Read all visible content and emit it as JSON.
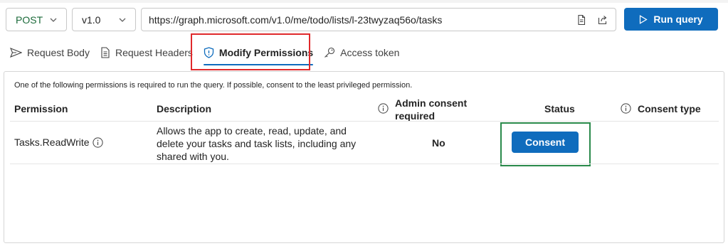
{
  "query_bar": {
    "method": "POST",
    "version": "v1.0",
    "url": "https://graph.microsoft.com/v1.0/me/todo/lists/l-23twyzaq56o/tasks",
    "run_label": "Run query"
  },
  "tabs": [
    {
      "label": "Request Body",
      "icon": "send-icon"
    },
    {
      "label": "Request Headers",
      "icon": "document-icon"
    },
    {
      "label": "Modify Permissions",
      "icon": "shield-icon",
      "active": true
    },
    {
      "label": "Access token",
      "icon": "key-icon"
    }
  ],
  "permissions": {
    "note": "One of the following permissions is required to run the query. If possible, consent to the least privileged permission.",
    "headers": {
      "permission": "Permission",
      "description": "Description",
      "admin_line1": "Admin consent",
      "admin_line2": "required",
      "status": "Status",
      "consent_type": "Consent type"
    },
    "rows": [
      {
        "permission": "Tasks.ReadWrite",
        "description_lines": [
          "Allows the app to create, read, update, and",
          "delete your tasks and task lists, including any",
          "shared with you."
        ],
        "admin_required": "No",
        "action": "Consent"
      }
    ]
  },
  "colors": {
    "accent": "#0f6cbd",
    "method_text": "#1b6a3a",
    "highlight_red": "#e0292b",
    "highlight_green": "#2a8a4b"
  }
}
